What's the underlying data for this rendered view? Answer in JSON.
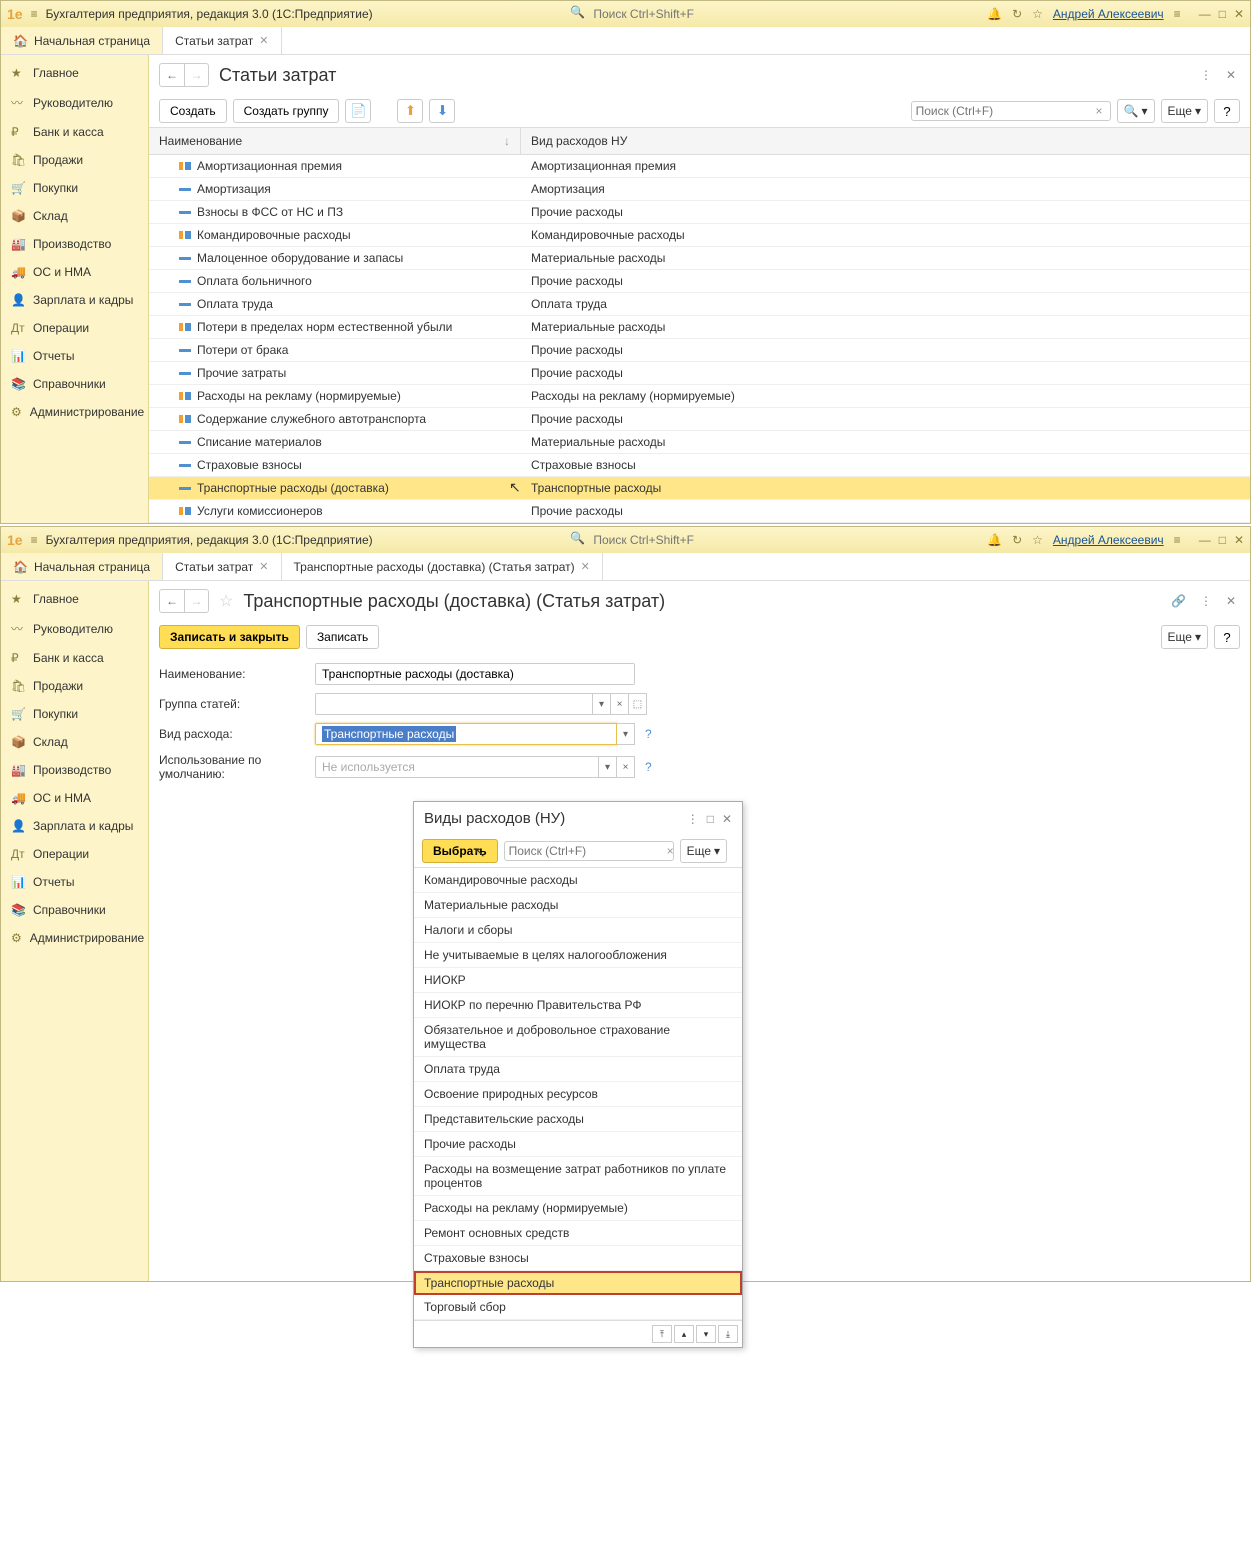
{
  "titlebar": {
    "app_title": "Бухгалтерия предприятия, редакция 3.0  (1С:Предприятие)",
    "search_placeholder": "Поиск Ctrl+Shift+F",
    "user": "Андрей Алексеевич"
  },
  "tabs_top": {
    "home": "Начальная страница",
    "tab1": "Статьи затрат"
  },
  "tabs_bottom": {
    "home": "Начальная страница",
    "tab1": "Статьи затрат",
    "tab2": "Транспортные расходы (доставка) (Статья затрат)"
  },
  "sidebar": {
    "items": [
      {
        "label": "Главное",
        "icon": "★"
      },
      {
        "label": "Руководителю",
        "icon": "〰"
      },
      {
        "label": "Банк и касса",
        "icon": "₽"
      },
      {
        "label": "Продажи",
        "icon": "🛍"
      },
      {
        "label": "Покупки",
        "icon": "🛒"
      },
      {
        "label": "Склад",
        "icon": "📦"
      },
      {
        "label": "Производство",
        "icon": "🏭"
      },
      {
        "label": "ОС и НМА",
        "icon": "🚚"
      },
      {
        "label": "Зарплата и кадры",
        "icon": "👤"
      },
      {
        "label": "Операции",
        "icon": "Дт"
      },
      {
        "label": "Отчеты",
        "icon": "📊"
      },
      {
        "label": "Справочники",
        "icon": "📚"
      },
      {
        "label": "Администрирование",
        "icon": "⚙"
      }
    ]
  },
  "page1": {
    "title": "Статьи затрат",
    "create_btn": "Создать",
    "create_group_btn": "Создать группу",
    "search_placeholder": "Поиск (Ctrl+F)",
    "more_btn": "Еще",
    "col1": "Наименование",
    "col2": "Вид расходов НУ",
    "rows": [
      {
        "name": "Амортизационная премия",
        "type": "Амортизационная премия",
        "icon": "eq"
      },
      {
        "name": "Амортизация",
        "type": "Амортизация",
        "icon": "dash"
      },
      {
        "name": "Взносы в ФСС от НС и ПЗ",
        "type": "Прочие расходы",
        "icon": "dash"
      },
      {
        "name": "Командировочные расходы",
        "type": "Командировочные расходы",
        "icon": "eq"
      },
      {
        "name": "Малоценное оборудование и запасы",
        "type": "Материальные расходы",
        "icon": "dash"
      },
      {
        "name": "Оплата больничного",
        "type": "Прочие расходы",
        "icon": "dash"
      },
      {
        "name": "Оплата труда",
        "type": "Оплата труда",
        "icon": "dash"
      },
      {
        "name": "Потери в пределах норм естественной убыли",
        "type": "Материальные расходы",
        "icon": "eq"
      },
      {
        "name": "Потери от брака",
        "type": "Прочие расходы",
        "icon": "dash"
      },
      {
        "name": "Прочие затраты",
        "type": "Прочие расходы",
        "icon": "dash"
      },
      {
        "name": "Расходы на рекламу (нормируемые)",
        "type": "Расходы на рекламу (нормируемые)",
        "icon": "eq"
      },
      {
        "name": "Содержание служебного автотранспорта",
        "type": "Прочие расходы",
        "icon": "eq"
      },
      {
        "name": "Списание материалов",
        "type": "Материальные расходы",
        "icon": "dash"
      },
      {
        "name": "Страховые взносы",
        "type": "Страховые взносы",
        "icon": "dash"
      },
      {
        "name": "Транспортные расходы (доставка)",
        "type": "Транспортные расходы",
        "icon": "dash",
        "selected": true
      },
      {
        "name": "Услуги комиссионеров",
        "type": "Прочие расходы",
        "icon": "eq"
      }
    ]
  },
  "page2": {
    "title": "Транспортные расходы (доставка) (Статья затрат)",
    "save_close_btn": "Записать и закрыть",
    "save_btn": "Записать",
    "more_btn": "Еще",
    "form": {
      "name_label": "Наименование:",
      "name_value": "Транспортные расходы (доставка)",
      "group_label": "Группа статей:",
      "group_value": "",
      "type_label": "Вид расхода:",
      "type_value": "Транспортные расходы",
      "usage_label": "Использование по умолчанию:",
      "usage_placeholder": "Не используется"
    }
  },
  "popup": {
    "title": "Виды расходов (НУ)",
    "select_btn": "Выбрать",
    "search_placeholder": "Поиск (Ctrl+F)",
    "more_btn": "Еще",
    "items": [
      "Командировочные расходы",
      "Материальные расходы",
      "Налоги и сборы",
      "Не учитываемые в целях налогообложения",
      "НИОКР",
      "НИОКР по перечню Правительства РФ",
      "Обязательное и добровольное страхование имущества",
      "Оплата труда",
      "Освоение природных ресурсов",
      "Представительские расходы",
      "Прочие расходы",
      "Расходы на возмещение затрат работников по уплате процентов",
      "Расходы на рекламу (нормируемые)",
      "Ремонт основных средств",
      "Страховые взносы",
      "Транспортные расходы",
      "Торговый сбор"
    ],
    "selected_index": 15
  }
}
